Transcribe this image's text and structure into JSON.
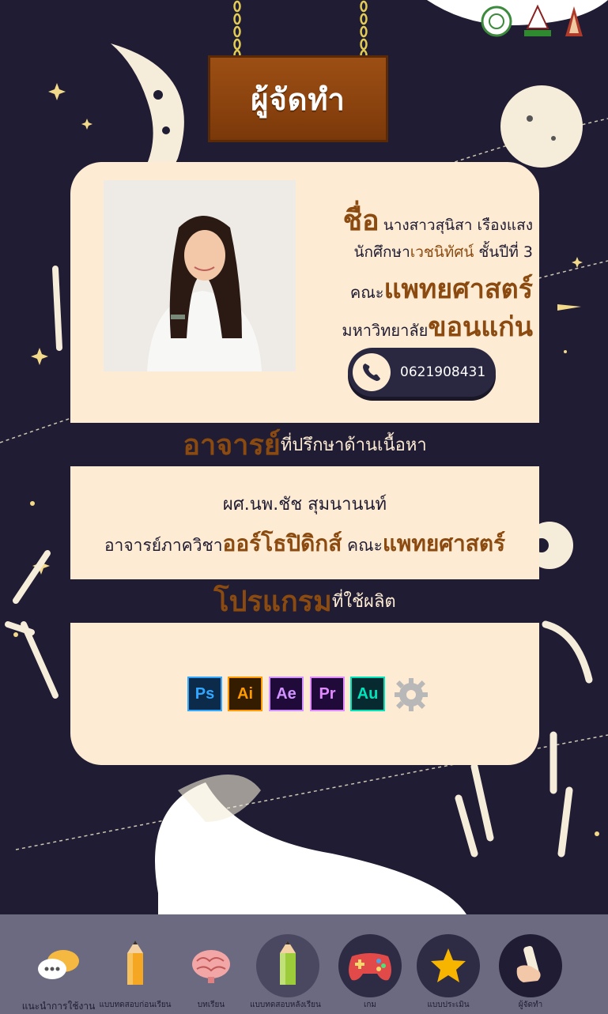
{
  "sign": {
    "title": "ผู้จัดทำ"
  },
  "maker": {
    "name_label": "ชื่อ",
    "name_value": "นางสาวสุนิสา เรืองแสง",
    "student_a": "นักศึกษา",
    "student_b": "เวชนิทัศน์",
    "student_c": " ชั้นปีที่ 3",
    "faculty_a": "คณะ",
    "faculty_b": "แพทยศาสตร์",
    "univ_a": "มหาวิทยาลัย",
    "univ_b": "ขอนแก่น",
    "phone": "0621908431"
  },
  "advisor": {
    "heading_a": "อาจารย์",
    "heading_b": "ที่ปรึกษาด้านเนื้อหา",
    "name": "ผศ.นพ.ชัช สุมนานนท์",
    "dept_a": "อาจารย์ภาควิชา",
    "dept_b": "ออร์โธปิดิกส์",
    "dept_c": " คณะ",
    "dept_d": "แพทยศาสตร์"
  },
  "program": {
    "heading_a": "โปรแกรม",
    "heading_b": "ที่ใช้ผลิต",
    "apps": [
      {
        "label": "Ps",
        "bg": "#0c2a4a",
        "fg": "#31a8ff",
        "border": "#31a8ff"
      },
      {
        "label": "Ai",
        "bg": "#331c00",
        "fg": "#ff9a00",
        "border": "#ff9a00"
      },
      {
        "label": "Ae",
        "bg": "#1f0a3a",
        "fg": "#d292ff",
        "border": "#d292ff"
      },
      {
        "label": "Pr",
        "bg": "#1f0a3a",
        "fg": "#e28bff",
        "border": "#e28bff"
      },
      {
        "label": "Au",
        "bg": "#062a30",
        "fg": "#00e4bb",
        "border": "#00e4bb"
      }
    ]
  },
  "nav": [
    {
      "label": "แนะนำการใช้งาน",
      "icon": "chat-bubbles-icon",
      "bg": "#dedde6"
    },
    {
      "label": "แบบทดสอบก่อนเรียน",
      "icon": "pencil-icon",
      "bg": "#dedde6"
    },
    {
      "label": "บทเรียน",
      "icon": "brain-icon",
      "bg": "#dedde6"
    },
    {
      "label": "แบบทดสอบหลังเรียน",
      "icon": "pencil-green-icon",
      "bg": "#4a4760"
    },
    {
      "label": "เกม",
      "icon": "gamepad-icon",
      "bg": "#2e2b45"
    },
    {
      "label": "แบบประเมิน",
      "icon": "star-icon",
      "bg": "#2e2b45"
    },
    {
      "label": "ผู้จัดทำ",
      "icon": "hand-scroll-icon",
      "bg": "#1f1c33"
    }
  ],
  "colors": {
    "background": "#1f1c33",
    "cream": "#fdebd3",
    "brown": "#8a4a10"
  }
}
